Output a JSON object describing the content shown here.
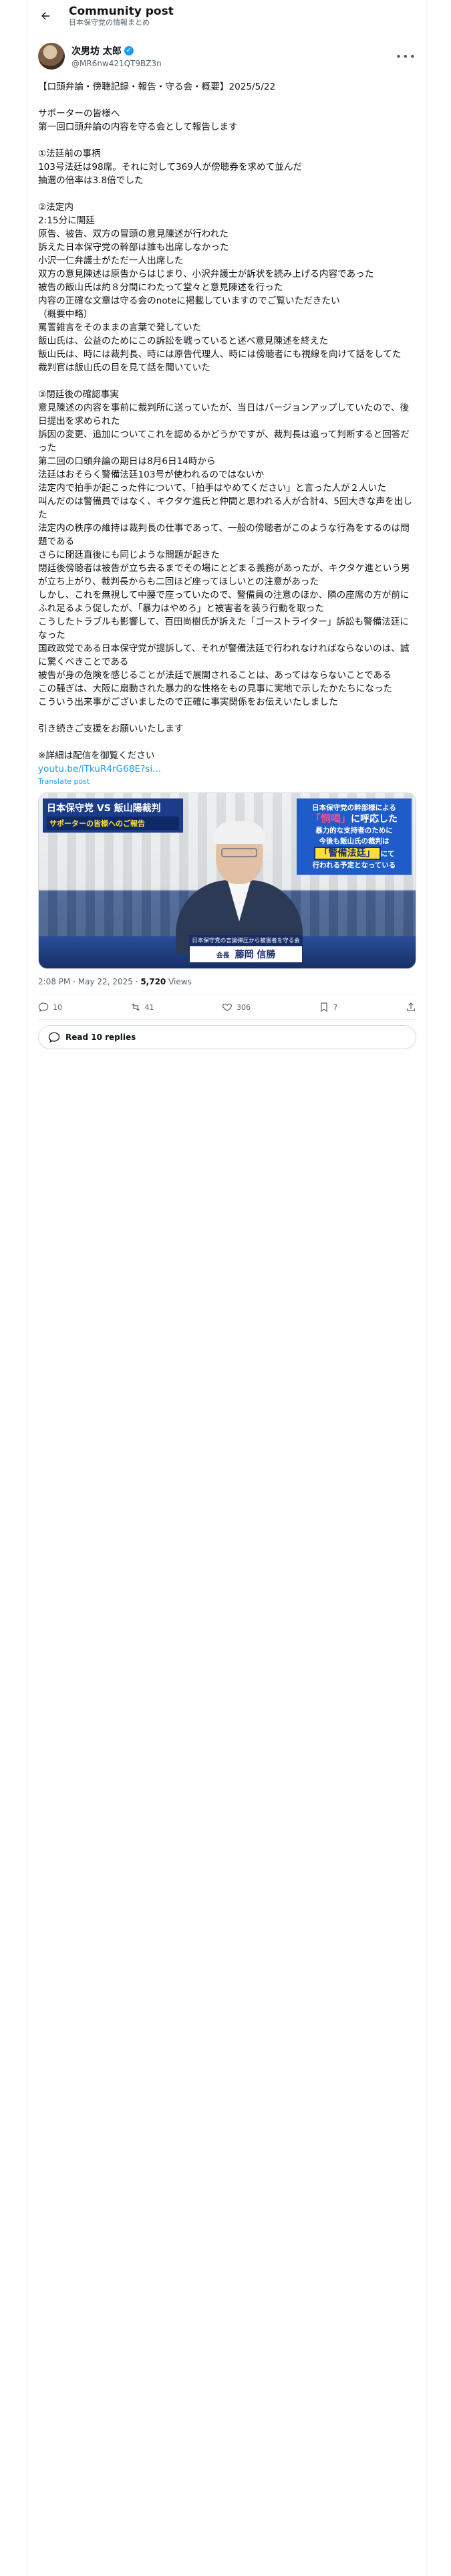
{
  "header": {
    "title": "Community post",
    "subtitle": "日本保守党の情報まとめ"
  },
  "author": {
    "display_name": "次男坊 太郎",
    "handle": "@MR6nw421QT9BZ3n"
  },
  "post": {
    "lines": [
      "【口頭弁論・傍聴記録・報告・守る会・概要】2025/5/22",
      "",
      "サポーターの皆様へ",
      "第一回口頭弁論の内容を守る会として報告します",
      "",
      "①法廷前の事柄",
      "103号法廷は98席。それに対して369人が傍聴券を求めて並んだ",
      "抽選の倍率は3.8倍でした",
      "",
      "②法定内",
      "2:15分に開廷",
      "原告、被告、双方の冒頭の意見陳述が行われた",
      "訴えた日本保守党の幹部は誰も出席しなかった",
      "小沢一仁弁護士がただ一人出席した",
      "双方の意見陳述は原告からはじまり、小沢弁護士が訴状を読み上げる内容であった",
      "被告の飯山氏は約８分間にわたって堂々と意見陳述を行った",
      "内容の正確な文章は守る会のnoteに掲載していますのでご覧いただきたい",
      "（概要中略）",
      "罵詈雑言をそのままの言葉で発していた",
      "飯山氏は、公益のためにこの訴訟を戦っていると述べ意見陳述を終えた",
      "飯山氏は、時には裁判長、時には原告代理人、時には傍聴者にも視線を向けて話をしてた",
      "裁判官は飯山氏の目を見て話を聞いていた",
      "",
      "③閉廷後の確認事実",
      "意見陳述の内容を事前に裁判所に送っていたが、当日はバージョンアップしていたので、後日提出を求められた",
      "訴因の変更、追加についてこれを認めるかどうかですが、裁判長は追って判断すると回答だった",
      "第二回の口頭弁論の期日は8月6日14時から",
      "法廷はおそらく警備法廷103号が使われるのではないか",
      "法定内で拍手が起こった件について、「拍手はやめてください」と言った人が２人いた",
      "叫んだのは警備員ではなく、キクタケ進氏と仲間と思われる人が合計4、5回大きな声を出した",
      "法定内の秩序の維持は裁判長の仕事であって、一般の傍聴者がこのような行為をするのは問題である",
      "さらに閉廷直後にも同じような問題が起きた",
      "閉廷後傍聴者は被告が立ち去るまでその場にとどまる義務があったが、キクタケ進という男が立ち上がり、裁判長からも二回ほど座ってほしいとの注意があった",
      "しかし、これを無視して中腰で座っていたので、警備員の注意のほか、隣の座席の方が前にふれ足るよう促したが、「暴力はやめろ」と被害者を装う行動を取った",
      "こうしたトラブルも影響して、百田尚樹氏が訴えた「ゴーストライター」訴訟も警備法廷になった",
      "国政政党である日本保守党が提訴して、それが警備法廷で行われなければならないのは、誠に驚くべきことである",
      "被告が身の危険を感じることが法廷で展開されることは、あってはならないことである",
      "この騒ぎは、大阪に扇動された暴力的な性格をもの見事に実地で示したかたちになった",
      "こういう出来事がございましたので正確に事実関係をお伝えいたしました",
      "",
      "引き続きご支援をお願いいたします",
      "",
      "※詳細は配信を御覧ください"
    ],
    "link_text": "youtu.be/iTkuR4rG68E?si...",
    "translate_label": "Translate post"
  },
  "media": {
    "left_title": "日本保守党 VS 飯山陽裁判",
    "left_subtitle": "サポーターの皆様へのご報告",
    "right_line1": "日本保守党の幹部様による",
    "right_highlight": "「恫喝」",
    "right_line2": "に呼応した",
    "right_line3": "暴力的な支持者のために",
    "right_line4": "今後も飯山氏の裁判は",
    "right_yellow": "「警備法廷」",
    "right_line5": "にて",
    "right_line6": "行われる予定となっている",
    "caption_top": "日本保守党の言論弾圧から被害者を守る会",
    "caption_role": "会長",
    "caption_name": "藤岡 信勝"
  },
  "meta": {
    "time": "2:08 PM · May 22, 2025 · ",
    "views_count": "5,720",
    "views_label": " Views"
  },
  "actions": {
    "replies": "10",
    "reposts": "41",
    "likes": "306",
    "bookmarks": "7"
  },
  "read_replies_label": "Read 10 replies",
  "colors": {
    "accent": "#1d9bf0",
    "text": "#0f1419",
    "muted": "#536471"
  }
}
